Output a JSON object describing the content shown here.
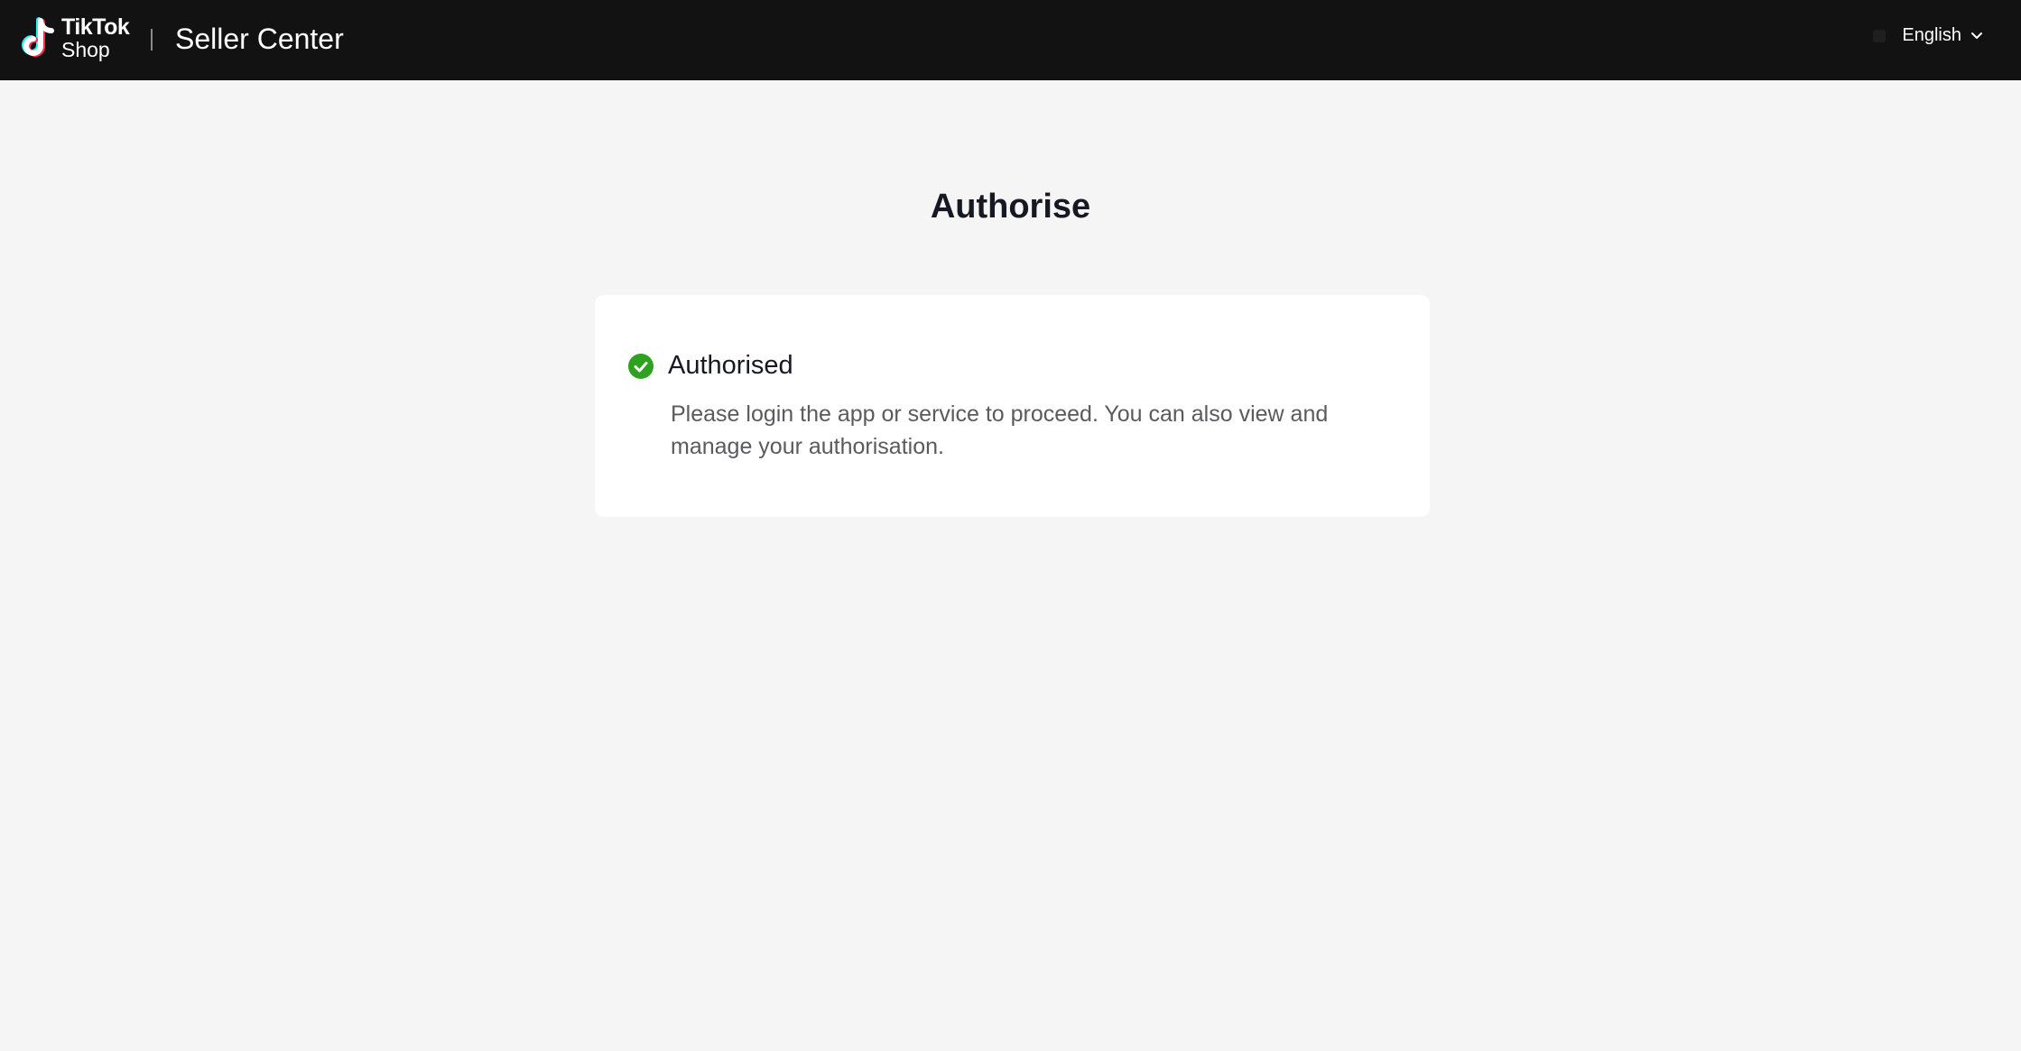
{
  "header": {
    "logo_line1": "TikTok",
    "logo_line2": "Shop",
    "product_name": "Seller Center",
    "language": "English",
    "background_color": "#121212"
  },
  "main": {
    "title": "Authorise",
    "card": {
      "status_title": "Authorised",
      "status_icon": "check-circle-icon",
      "status_color": "#2ea121",
      "description": "Please login the app or service to proceed. You can also view and manage your authorisation."
    }
  }
}
